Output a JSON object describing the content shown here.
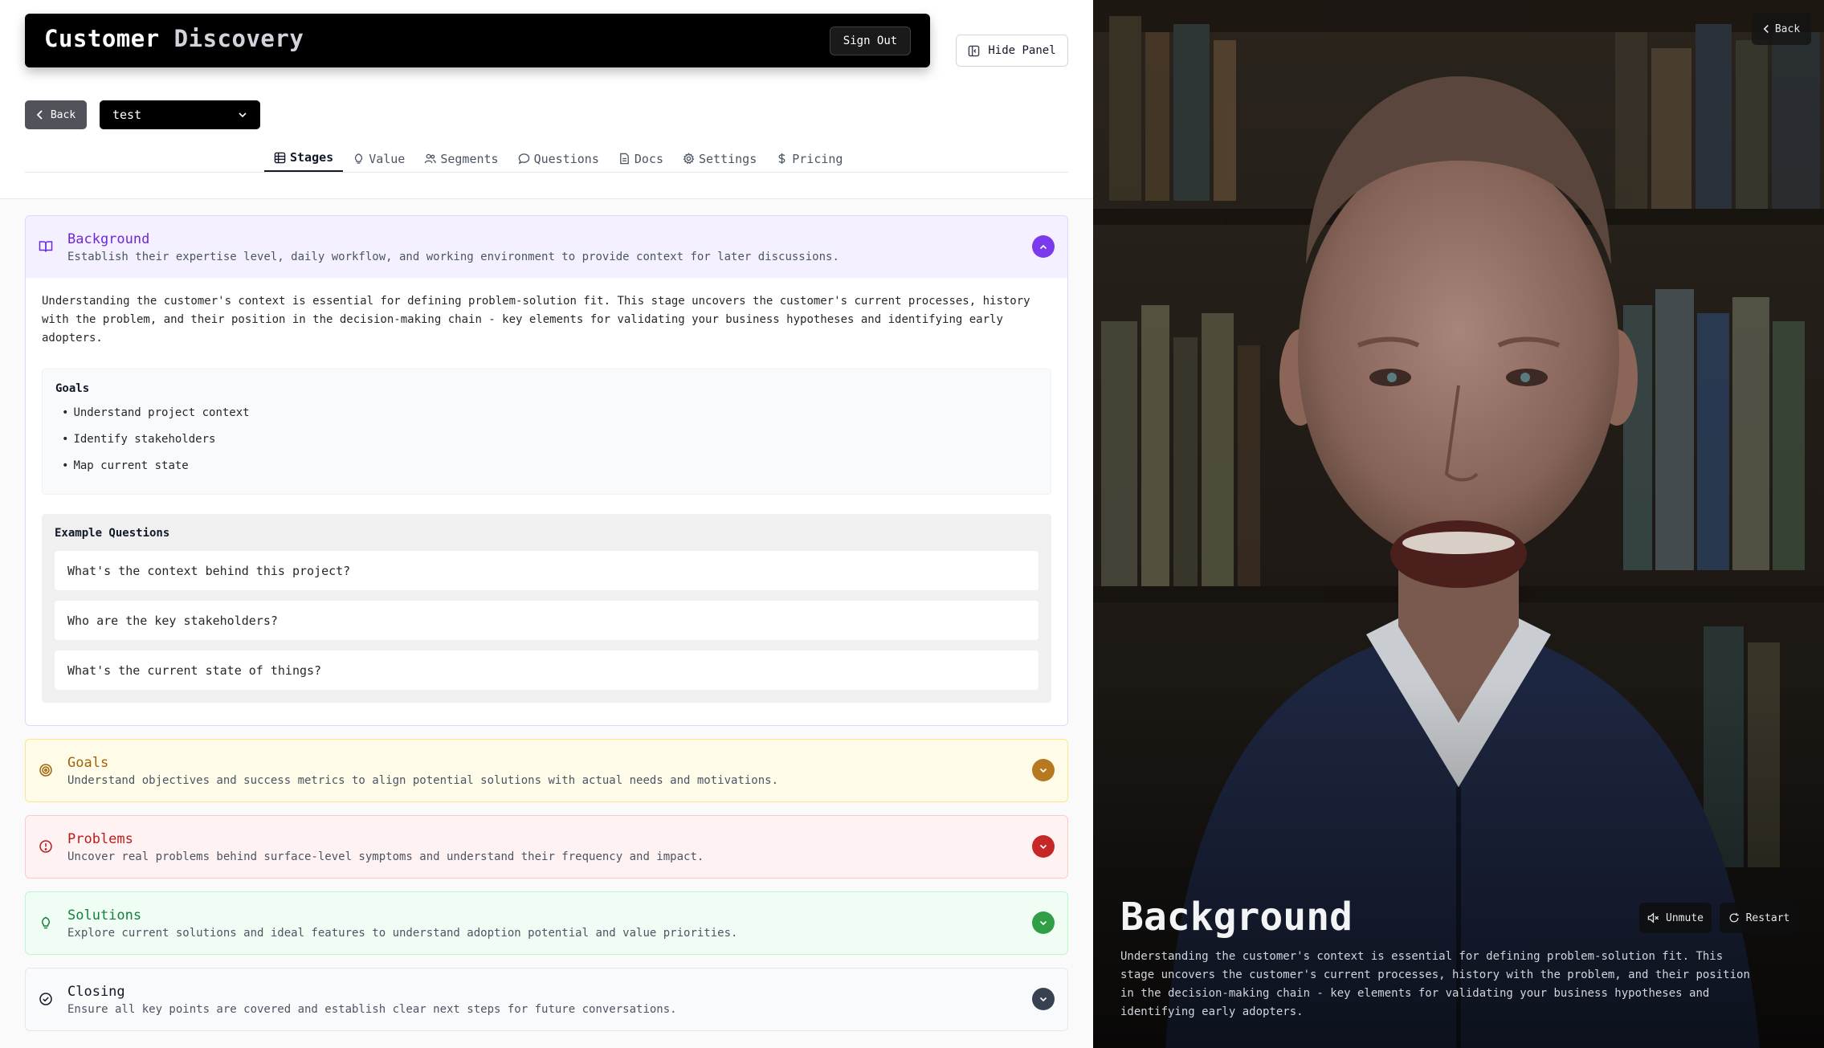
{
  "header": {
    "title_part1": "Customer",
    "title_part2": "Discovery",
    "sign_out_label": "Sign Out"
  },
  "hide_panel_label": "Hide Panel",
  "toolbar": {
    "back_label": "Back",
    "project_selected": "test"
  },
  "tabs": [
    {
      "label": "Stages",
      "icon": "list-icon",
      "active": true
    },
    {
      "label": "Value",
      "icon": "lightbulb-icon"
    },
    {
      "label": "Segments",
      "icon": "users-icon"
    },
    {
      "label": "Questions",
      "icon": "message-icon"
    },
    {
      "label": "Docs",
      "icon": "document-icon"
    },
    {
      "label": "Settings",
      "icon": "gear-icon"
    },
    {
      "label": "Pricing",
      "icon": "dollar-icon"
    }
  ],
  "stages": {
    "background": {
      "name": "Background",
      "icon": "book-icon",
      "description": "Establish their expertise level, daily workflow, and working environment to provide context for later discussions.",
      "intro": "Understanding the customer's context is essential for defining problem-solution fit. This stage uncovers the customer's current processes, history with the problem, and their position in the decision-making chain - key elements for validating your business hypotheses and identifying early adopters.",
      "goals_heading": "Goals",
      "goals": [
        "Understand project context",
        "Identify stakeholders",
        "Map current state"
      ],
      "examples_heading": "Example Questions",
      "examples": [
        "What's the context behind this project?",
        "Who are the key stakeholders?",
        "What's the current state of things?"
      ]
    },
    "goals": {
      "name": "Goals",
      "icon": "target-icon",
      "description": "Understand objectives and success metrics to align potential solutions with actual needs and motivations."
    },
    "problems": {
      "name": "Problems",
      "icon": "alert-circle-icon",
      "description": "Uncover real problems behind surface-level symptoms and understand their frequency and impact."
    },
    "solutions": {
      "name": "Solutions",
      "icon": "lightbulb-icon",
      "description": "Explore current solutions and ideal features to understand adoption potential and value priorities."
    },
    "closing": {
      "name": "Closing",
      "icon": "check-circle-icon",
      "description": "Ensure all key points are covered and establish clear next steps for future conversations."
    }
  },
  "video": {
    "back_label": "Back",
    "title": "Background",
    "description": "Understanding the customer's context is essential for defining problem-solution fit. This stage uncovers the customer's current processes, history with the problem, and their position in the decision-making chain - key elements for validating your business hypotheses and identifying early adopters.",
    "unmute_label": "Unmute",
    "restart_label": "Restart"
  },
  "colors": {
    "background_accent": "#7c3aed",
    "goals_accent": "#b7791f",
    "problems_accent": "#c62828",
    "solutions_accent": "#2f9e44",
    "closing_accent": "#374151"
  }
}
